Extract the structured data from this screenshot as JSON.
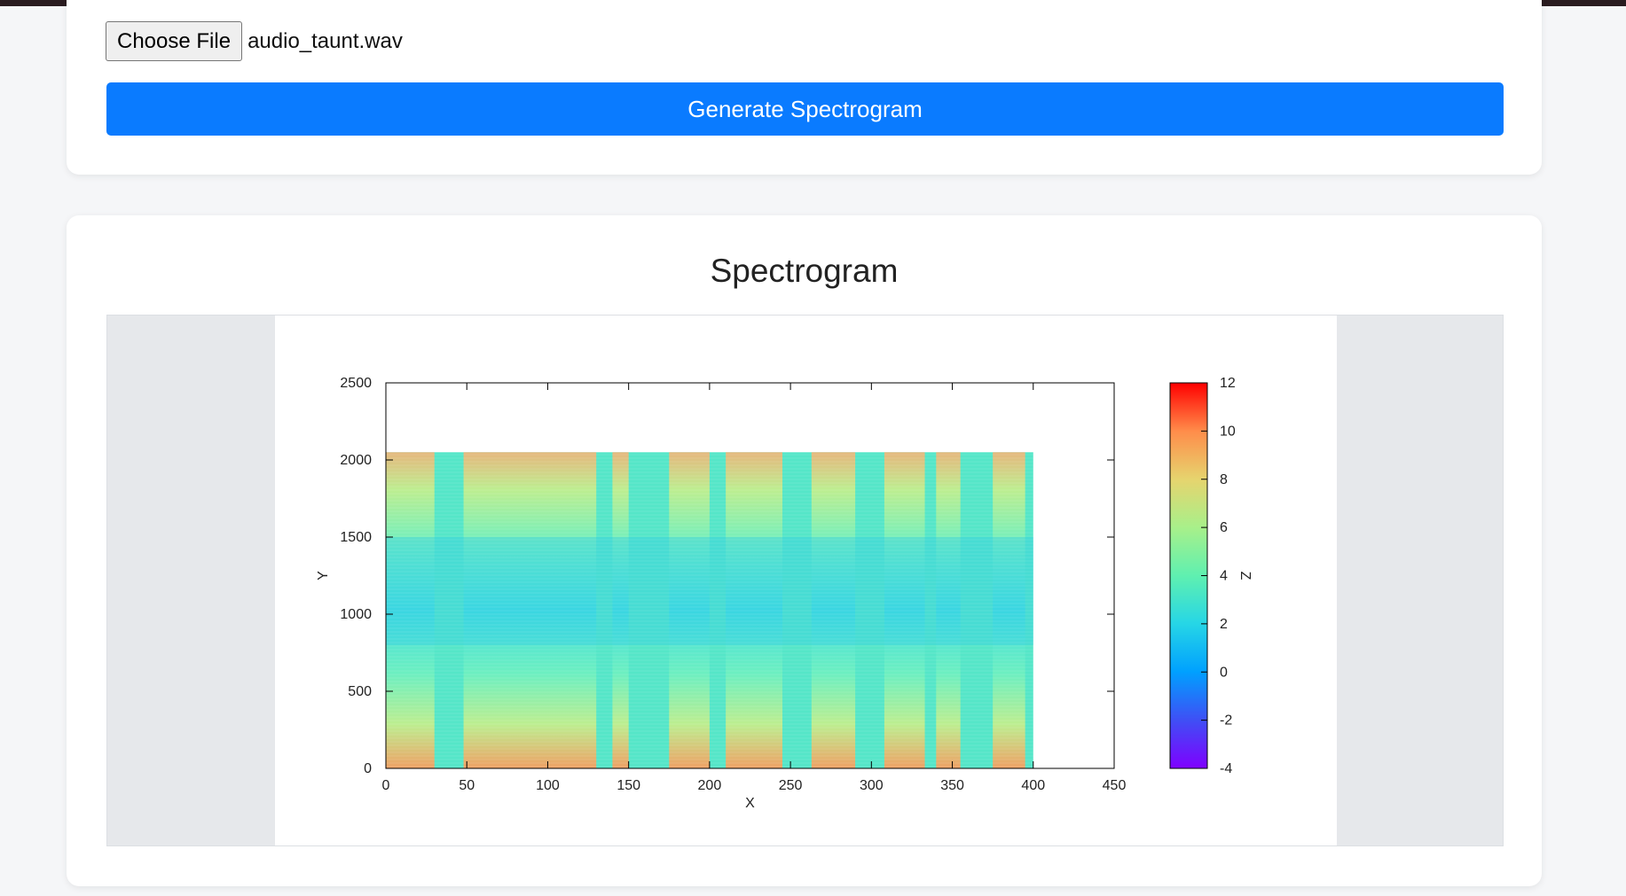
{
  "upload": {
    "choose_file_label": "Choose File",
    "file_name": "audio_taunt.wav",
    "generate_label": "Generate Spectrogram"
  },
  "result": {
    "title": "Spectrogram"
  },
  "colors": {
    "accent": "#0a7bff",
    "page_bg": "#f5f6f8",
    "frame_bg": "#e6e8eb"
  },
  "chart_data": {
    "type": "heatmap",
    "title": "",
    "xlabel": "X",
    "ylabel": "Y",
    "zlabel": "Z",
    "xlim": [
      0,
      450
    ],
    "ylim": [
      0,
      2500
    ],
    "zlim": [
      -4,
      12
    ],
    "x_ticks": [
      "0",
      "50",
      "100",
      "150",
      "200",
      "250",
      "300",
      "350",
      "400",
      "450"
    ],
    "y_ticks": [
      "0",
      "500",
      "1000",
      "1500",
      "2000",
      "2500"
    ],
    "z_ticks": [
      "-4",
      "-2",
      "0",
      "2",
      "4",
      "6",
      "8",
      "10",
      "12"
    ],
    "data_extent": {
      "x": [
        0,
        400
      ],
      "y": [
        0,
        2050
      ]
    },
    "colormap": [
      "#7f00ff",
      "#3f4ff5",
      "#00a0ff",
      "#26d6e6",
      "#5ff0b0",
      "#a8f08a",
      "#e6d46e",
      "#ff8c4a",
      "#ff0000"
    ],
    "grid": false,
    "colorbar": "right",
    "loud_segments_x": [
      [
        0,
        30
      ],
      [
        48,
        130
      ],
      [
        140,
        150
      ],
      [
        175,
        200
      ],
      [
        210,
        245
      ],
      [
        263,
        290
      ],
      [
        308,
        333
      ],
      [
        340,
        355
      ],
      [
        375,
        395
      ]
    ]
  }
}
